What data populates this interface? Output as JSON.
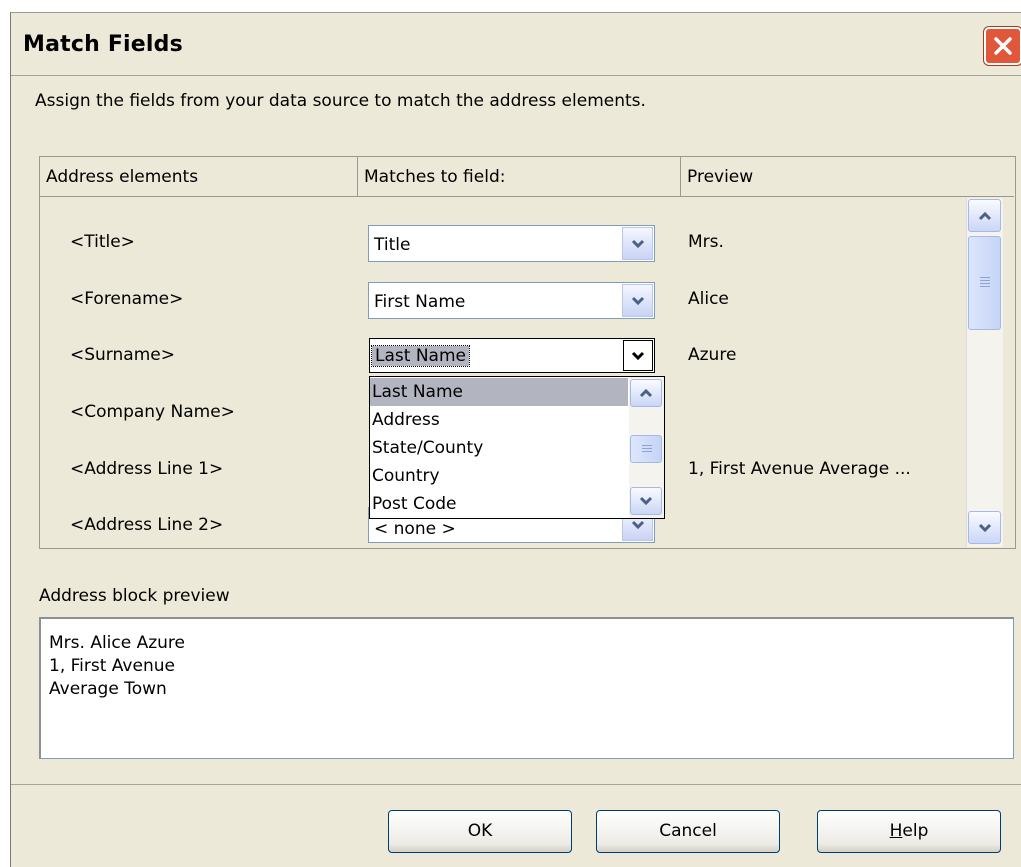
{
  "dialog": {
    "title": "Match Fields",
    "instruction": "Assign the fields from your data source to match the address elements."
  },
  "table": {
    "headers": [
      "Address elements",
      "Matches to field:",
      "Preview"
    ],
    "rows": [
      {
        "element": "<Title>",
        "field": "Title",
        "preview": "Mrs."
      },
      {
        "element": "<Forename>",
        "field": "First Name",
        "preview": "Alice"
      },
      {
        "element": "<Surname>",
        "field": "Last Name",
        "preview": "Azure"
      },
      {
        "element": "<Company Name>",
        "field": "",
        "preview": ""
      },
      {
        "element": "<Address Line 1>",
        "field": "",
        "preview": "1, First Avenue Average ..."
      },
      {
        "element": "<Address Line 2>",
        "field": "< none >",
        "preview": ""
      }
    ]
  },
  "dropdown": {
    "items": [
      "Last Name",
      "Address",
      "State/County",
      "Country",
      "Post Code"
    ],
    "selected": "Last Name"
  },
  "address_block": {
    "label": "Address block preview",
    "lines": [
      "Mrs. Alice Azure",
      "1, First Avenue",
      "Average Town"
    ]
  },
  "buttons": {
    "ok": "OK",
    "cancel": "Cancel",
    "help_mnemonic": "H",
    "help_rest": "elp"
  },
  "icons": {
    "close": "close-icon",
    "dropdown_arrow": "chevron-down-icon",
    "scroll_up": "chevron-up-icon",
    "scroll_down": "chevron-down-icon",
    "scroll_thumb": "scroll-thumb-grip-icon"
  }
}
